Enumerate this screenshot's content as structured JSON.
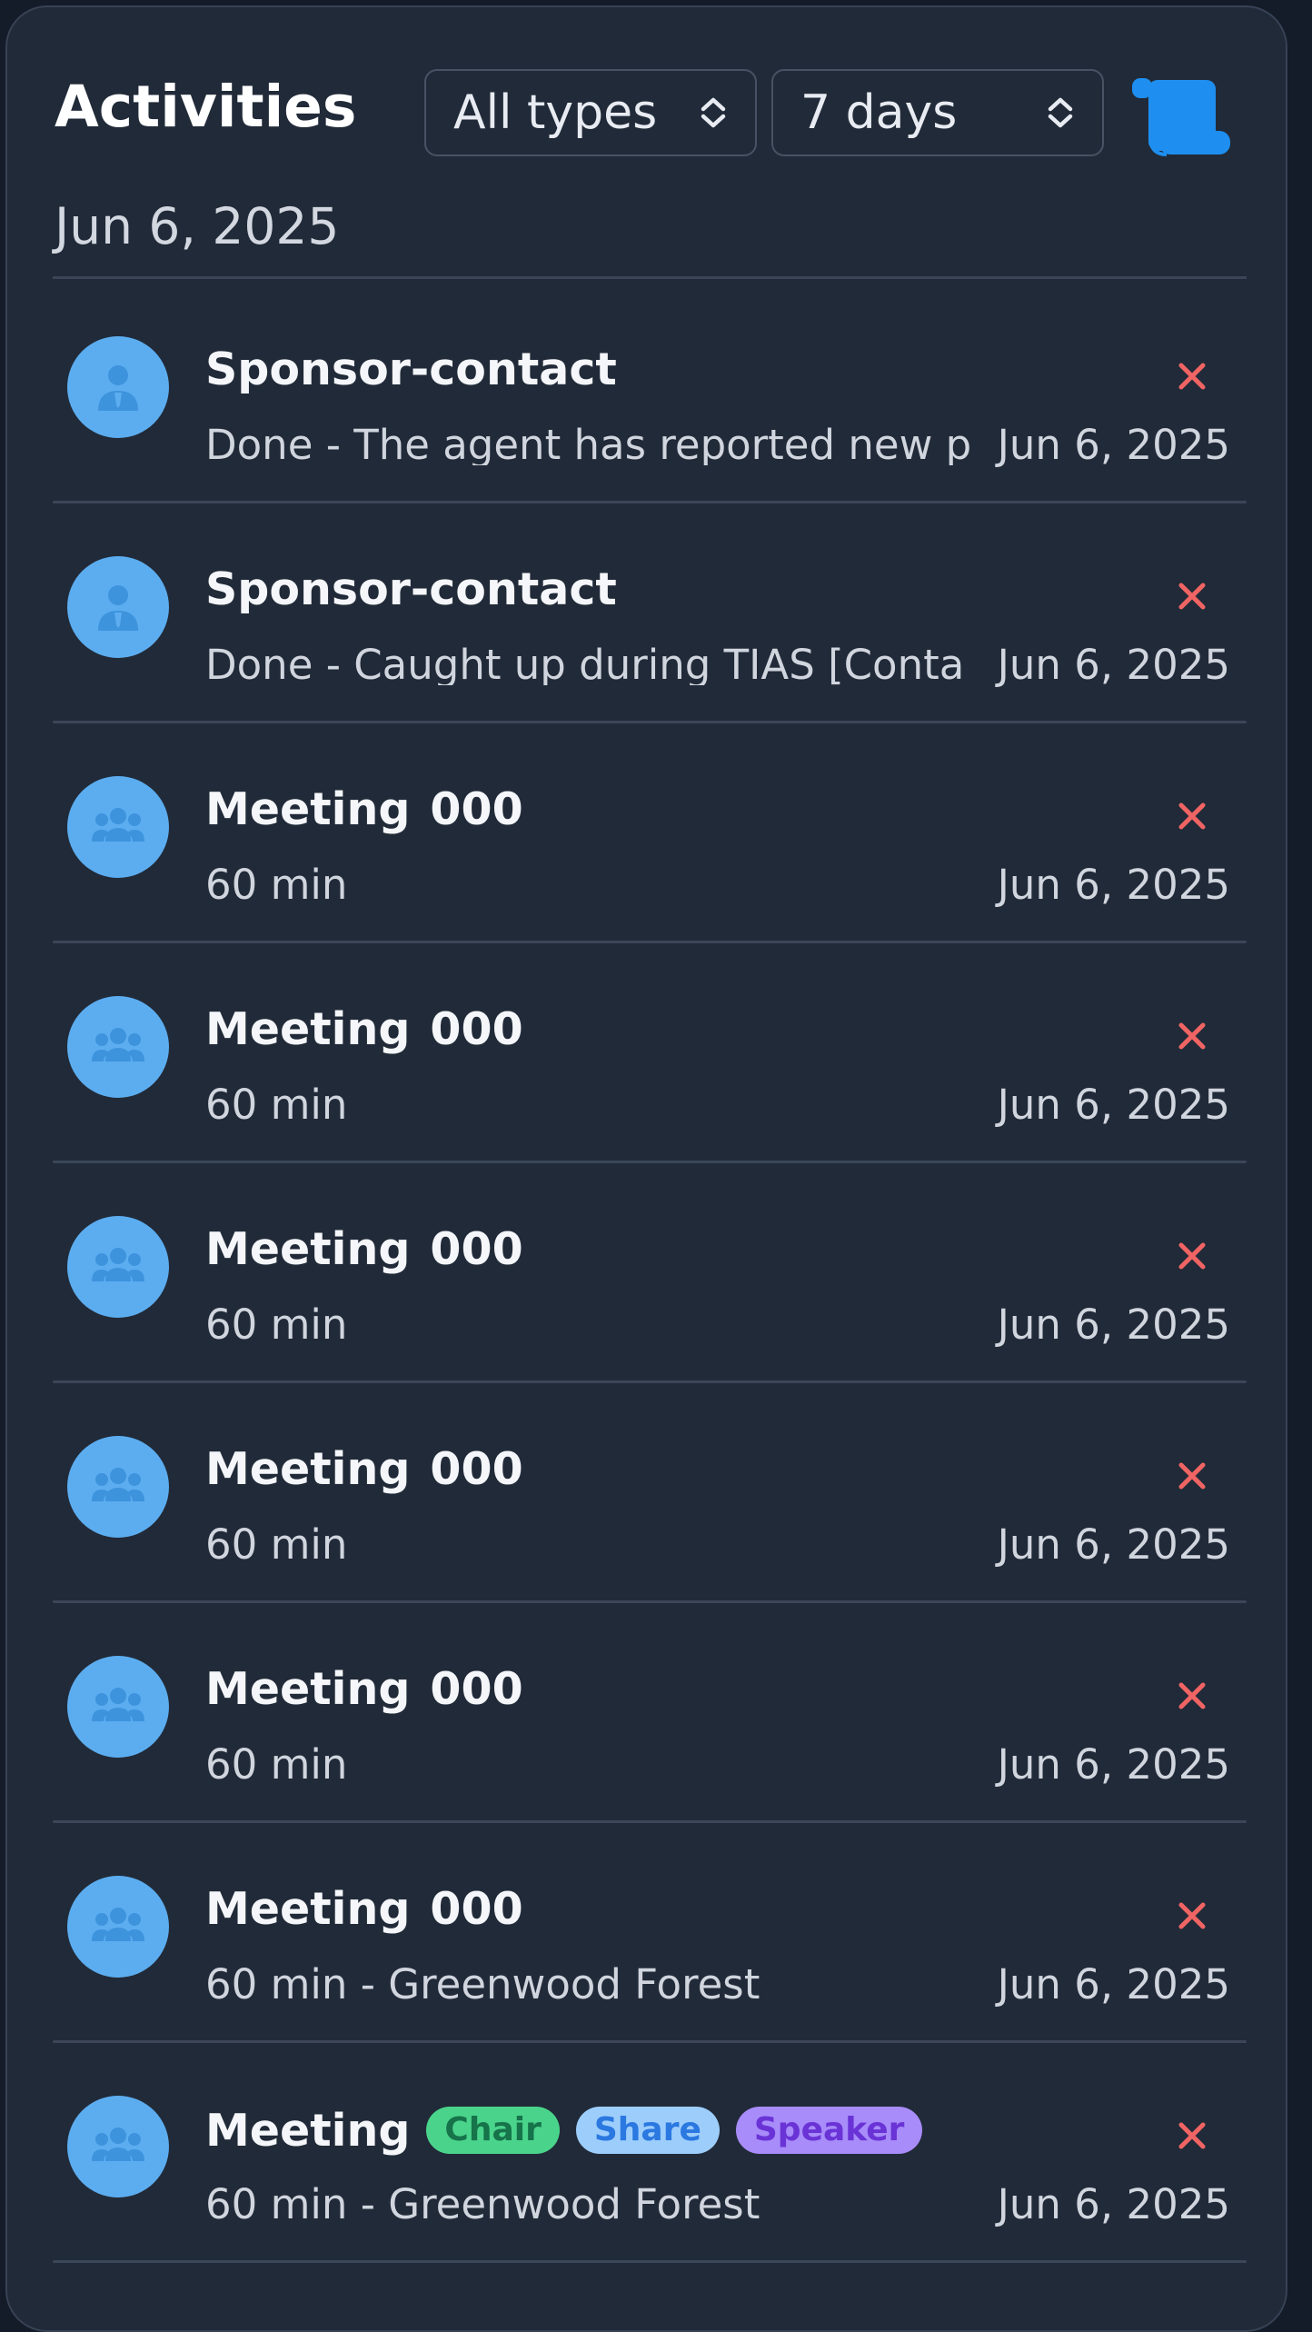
{
  "header": {
    "title": "Activities",
    "type_filter": "All types",
    "range_filter": "7 days",
    "log_icon": "scroll-icon"
  },
  "date_heading": "Jun 6, 2025",
  "colors": {
    "panel_bg": "#212a38",
    "avatar_bg": "#5cadf0",
    "delete": "#f06464",
    "accent": "#1e8ff0"
  },
  "activities": [
    {
      "kind": "person",
      "title": "Sponsor-contact",
      "suffix": "",
      "subtitle": "Done - The agent has reported new p",
      "date": "Jun 6, 2025",
      "tags": []
    },
    {
      "kind": "person",
      "title": "Sponsor-contact",
      "suffix": "",
      "subtitle": "Done - Caught up during TIAS [Conta",
      "date": "Jun 6, 2025",
      "tags": []
    },
    {
      "kind": "group",
      "title": "Meeting",
      "suffix": "000",
      "subtitle": "60 min",
      "date": "Jun 6, 2025",
      "tags": []
    },
    {
      "kind": "group",
      "title": "Meeting",
      "suffix": "000",
      "subtitle": "60 min",
      "date": "Jun 6, 2025",
      "tags": []
    },
    {
      "kind": "group",
      "title": "Meeting",
      "suffix": "000",
      "subtitle": "60 min",
      "date": "Jun 6, 2025",
      "tags": []
    },
    {
      "kind": "group",
      "title": "Meeting",
      "suffix": "000",
      "subtitle": "60 min",
      "date": "Jun 6, 2025",
      "tags": []
    },
    {
      "kind": "group",
      "title": "Meeting",
      "suffix": "000",
      "subtitle": "60 min",
      "date": "Jun 6, 2025",
      "tags": []
    },
    {
      "kind": "group",
      "title": "Meeting",
      "suffix": "000",
      "subtitle": "60 min - Greenwood Forest",
      "date": "Jun 6, 2025",
      "tags": []
    },
    {
      "kind": "group",
      "title": "Meeting",
      "suffix": "",
      "subtitle": "60 min - Greenwood Forest",
      "date": "Jun 6, 2025",
      "tags": [
        {
          "label": "Chair",
          "color": "green"
        },
        {
          "label": "Share",
          "color": "blue"
        },
        {
          "label": "Speaker",
          "color": "purple"
        }
      ]
    }
  ]
}
